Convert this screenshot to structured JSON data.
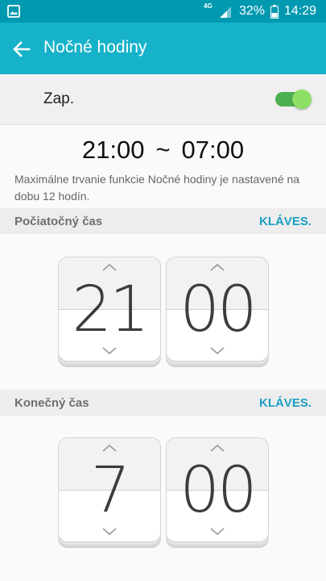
{
  "status": {
    "network": "4G",
    "battery_pct": "32%",
    "time": "14:29"
  },
  "appbar": {
    "title": "Nočné hodiny"
  },
  "master": {
    "label": "Zap.",
    "enabled": true
  },
  "range": {
    "start": "21:00",
    "separator": "~",
    "end": "07:00"
  },
  "description": "Maximálne trvanie funkcie Nočné hodiny je nastavené na dobu 12 hodín.",
  "start_section": {
    "title": "Počiatočný čas",
    "keyboard_label": "KLÁVES.",
    "hour": "21",
    "minute": "00"
  },
  "end_section": {
    "title": "Konečný čas",
    "keyboard_label": "KLÁVES.",
    "hour": "7",
    "minute": "00"
  },
  "colors": {
    "status_bar": "#0099b0",
    "app_bar": "#16b2ca",
    "accent": "#1a9fc2",
    "switch_on": "#4caf50"
  }
}
